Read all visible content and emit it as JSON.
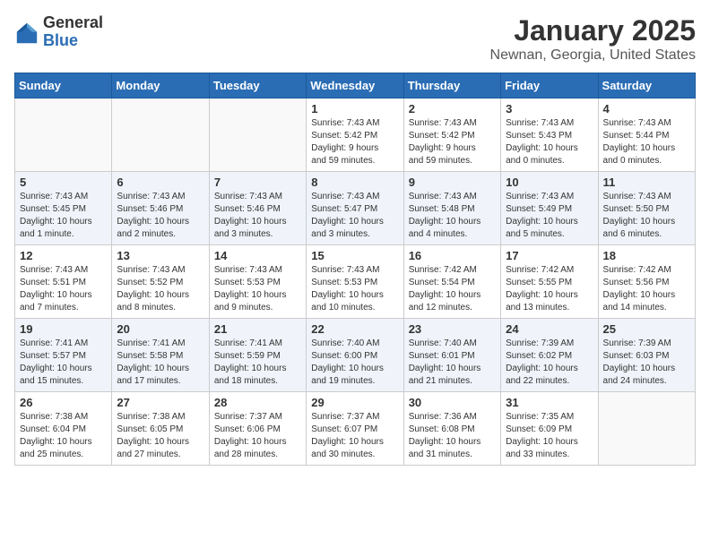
{
  "header": {
    "logo": {
      "general": "General",
      "blue": "Blue"
    },
    "month": "January 2025",
    "location": "Newnan, Georgia, United States"
  },
  "weekdays": [
    "Sunday",
    "Monday",
    "Tuesday",
    "Wednesday",
    "Thursday",
    "Friday",
    "Saturday"
  ],
  "weeks": [
    [
      {
        "day": null,
        "info": null
      },
      {
        "day": null,
        "info": null
      },
      {
        "day": null,
        "info": null
      },
      {
        "day": "1",
        "info": "Sunrise: 7:43 AM\nSunset: 5:42 PM\nDaylight: 9 hours\nand 59 minutes."
      },
      {
        "day": "2",
        "info": "Sunrise: 7:43 AM\nSunset: 5:42 PM\nDaylight: 9 hours\nand 59 minutes."
      },
      {
        "day": "3",
        "info": "Sunrise: 7:43 AM\nSunset: 5:43 PM\nDaylight: 10 hours\nand 0 minutes."
      },
      {
        "day": "4",
        "info": "Sunrise: 7:43 AM\nSunset: 5:44 PM\nDaylight: 10 hours\nand 0 minutes."
      }
    ],
    [
      {
        "day": "5",
        "info": "Sunrise: 7:43 AM\nSunset: 5:45 PM\nDaylight: 10 hours\nand 1 minute."
      },
      {
        "day": "6",
        "info": "Sunrise: 7:43 AM\nSunset: 5:46 PM\nDaylight: 10 hours\nand 2 minutes."
      },
      {
        "day": "7",
        "info": "Sunrise: 7:43 AM\nSunset: 5:46 PM\nDaylight: 10 hours\nand 3 minutes."
      },
      {
        "day": "8",
        "info": "Sunrise: 7:43 AM\nSunset: 5:47 PM\nDaylight: 10 hours\nand 3 minutes."
      },
      {
        "day": "9",
        "info": "Sunrise: 7:43 AM\nSunset: 5:48 PM\nDaylight: 10 hours\nand 4 minutes."
      },
      {
        "day": "10",
        "info": "Sunrise: 7:43 AM\nSunset: 5:49 PM\nDaylight: 10 hours\nand 5 minutes."
      },
      {
        "day": "11",
        "info": "Sunrise: 7:43 AM\nSunset: 5:50 PM\nDaylight: 10 hours\nand 6 minutes."
      }
    ],
    [
      {
        "day": "12",
        "info": "Sunrise: 7:43 AM\nSunset: 5:51 PM\nDaylight: 10 hours\nand 7 minutes."
      },
      {
        "day": "13",
        "info": "Sunrise: 7:43 AM\nSunset: 5:52 PM\nDaylight: 10 hours\nand 8 minutes."
      },
      {
        "day": "14",
        "info": "Sunrise: 7:43 AM\nSunset: 5:53 PM\nDaylight: 10 hours\nand 9 minutes."
      },
      {
        "day": "15",
        "info": "Sunrise: 7:43 AM\nSunset: 5:53 PM\nDaylight: 10 hours\nand 10 minutes."
      },
      {
        "day": "16",
        "info": "Sunrise: 7:42 AM\nSunset: 5:54 PM\nDaylight: 10 hours\nand 12 minutes."
      },
      {
        "day": "17",
        "info": "Sunrise: 7:42 AM\nSunset: 5:55 PM\nDaylight: 10 hours\nand 13 minutes."
      },
      {
        "day": "18",
        "info": "Sunrise: 7:42 AM\nSunset: 5:56 PM\nDaylight: 10 hours\nand 14 minutes."
      }
    ],
    [
      {
        "day": "19",
        "info": "Sunrise: 7:41 AM\nSunset: 5:57 PM\nDaylight: 10 hours\nand 15 minutes."
      },
      {
        "day": "20",
        "info": "Sunrise: 7:41 AM\nSunset: 5:58 PM\nDaylight: 10 hours\nand 17 minutes."
      },
      {
        "day": "21",
        "info": "Sunrise: 7:41 AM\nSunset: 5:59 PM\nDaylight: 10 hours\nand 18 minutes."
      },
      {
        "day": "22",
        "info": "Sunrise: 7:40 AM\nSunset: 6:00 PM\nDaylight: 10 hours\nand 19 minutes."
      },
      {
        "day": "23",
        "info": "Sunrise: 7:40 AM\nSunset: 6:01 PM\nDaylight: 10 hours\nand 21 minutes."
      },
      {
        "day": "24",
        "info": "Sunrise: 7:39 AM\nSunset: 6:02 PM\nDaylight: 10 hours\nand 22 minutes."
      },
      {
        "day": "25",
        "info": "Sunrise: 7:39 AM\nSunset: 6:03 PM\nDaylight: 10 hours\nand 24 minutes."
      }
    ],
    [
      {
        "day": "26",
        "info": "Sunrise: 7:38 AM\nSunset: 6:04 PM\nDaylight: 10 hours\nand 25 minutes."
      },
      {
        "day": "27",
        "info": "Sunrise: 7:38 AM\nSunset: 6:05 PM\nDaylight: 10 hours\nand 27 minutes."
      },
      {
        "day": "28",
        "info": "Sunrise: 7:37 AM\nSunset: 6:06 PM\nDaylight: 10 hours\nand 28 minutes."
      },
      {
        "day": "29",
        "info": "Sunrise: 7:37 AM\nSunset: 6:07 PM\nDaylight: 10 hours\nand 30 minutes."
      },
      {
        "day": "30",
        "info": "Sunrise: 7:36 AM\nSunset: 6:08 PM\nDaylight: 10 hours\nand 31 minutes."
      },
      {
        "day": "31",
        "info": "Sunrise: 7:35 AM\nSunset: 6:09 PM\nDaylight: 10 hours\nand 33 minutes."
      },
      {
        "day": null,
        "info": null
      }
    ]
  ]
}
